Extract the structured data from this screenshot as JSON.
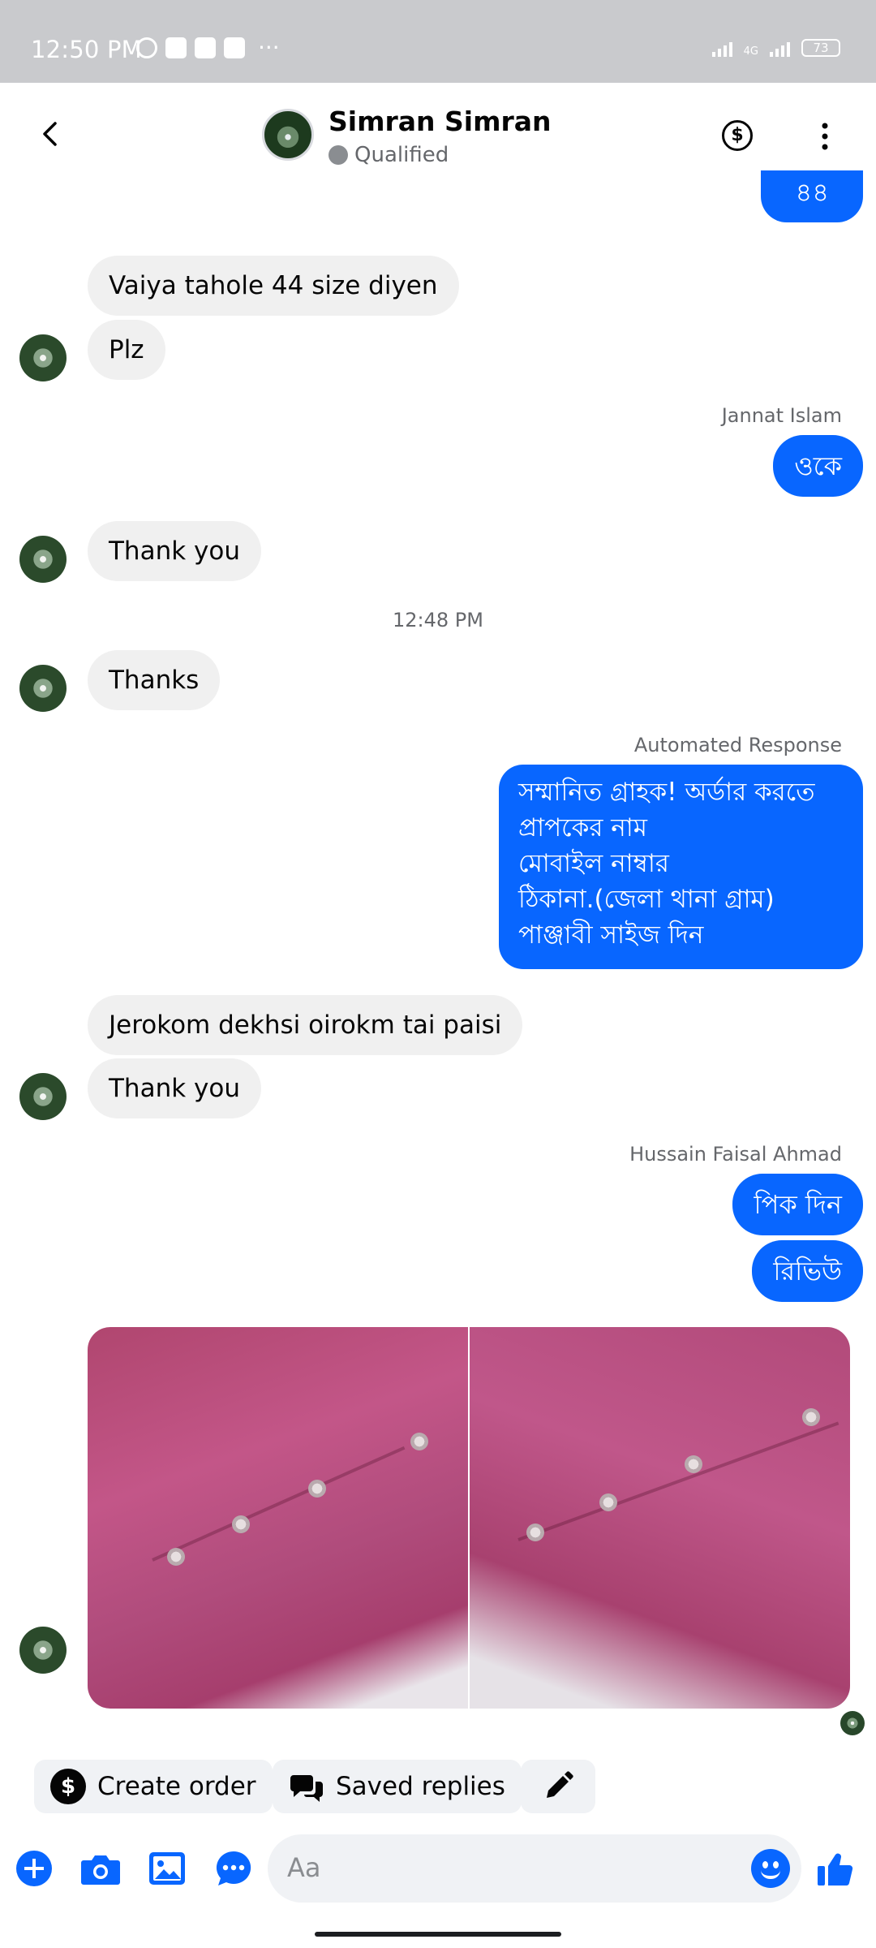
{
  "status_bar": {
    "time": "12:50 PM",
    "battery": "73",
    "network": "4G",
    "more": "···"
  },
  "header": {
    "contact_name": "Simran Simran",
    "status": "Qualified"
  },
  "messages": {
    "out_partial": "৪৪",
    "in_1": "Vaiya tahole 44 size diyen",
    "in_2": "Plz",
    "sender_1": "Jannat Islam",
    "out_1": "ওকে",
    "in_3": "Thank you",
    "time_divider": "12:48 PM",
    "in_4": "Thanks",
    "sender_2": "Automated Response",
    "auto_lines": [
      "সম্মানিত গ্রাহক!  অর্ডার করতে",
      "প্রাপকের নাম",
      "মোবাইল নাম্বার",
      "ঠিকানা.(জেলা থানা গ্রাম)",
      "পাঞ্জাবী সাইজ দিন"
    ],
    "in_5": "Jerokom dekhsi oirokm tai paisi",
    "in_6": "Thank you",
    "sender_3": "Hussain Faisal Ahmad",
    "out_2": "পিক দিন",
    "out_3": "রিভিউ"
  },
  "quick_actions": {
    "create_order": "Create order",
    "saved_replies": "Saved replies"
  },
  "composer": {
    "placeholder": "Aa"
  },
  "colors": {
    "accent": "#0866ff",
    "incoming_bubble": "#f0f0f0",
    "muted_text": "#65676b"
  },
  "icons": [
    "back-arrow-icon",
    "dollar-icon",
    "more-vertical-icon",
    "plus-icon",
    "camera-icon",
    "gallery-icon",
    "chat-bubble-icon",
    "emoji-icon",
    "like-icon",
    "edit-icon"
  ]
}
